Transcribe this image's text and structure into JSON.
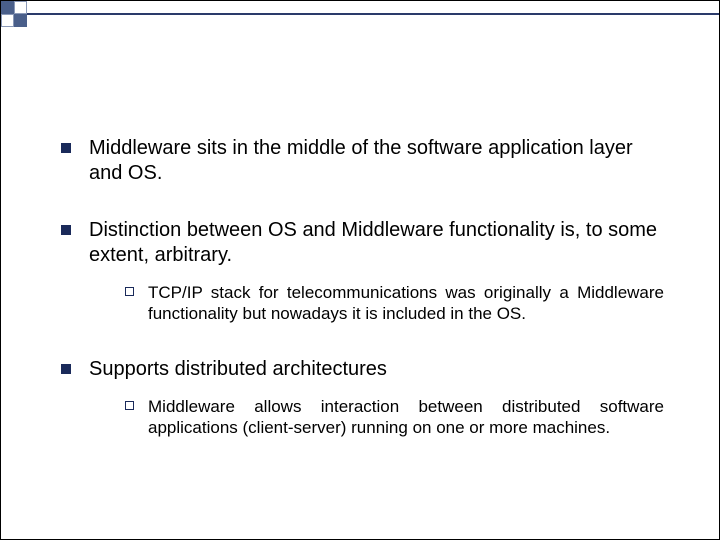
{
  "slide": {
    "bullets": [
      {
        "text": "Middleware sits in the middle of the software application layer and OS.",
        "subs": []
      },
      {
        "text": "Distinction between OS and Middleware functionality is, to some extent, arbitrary.",
        "subs": [
          {
            "text": "TCP/IP stack for telecommunications was originally a Middleware functionality but nowadays it is included in the OS."
          }
        ]
      },
      {
        "text": "Supports distributed architectures",
        "subs": [
          {
            "text": "Middleware allows interaction between distributed software applications (client-server) running on one or more machines."
          }
        ]
      }
    ]
  }
}
